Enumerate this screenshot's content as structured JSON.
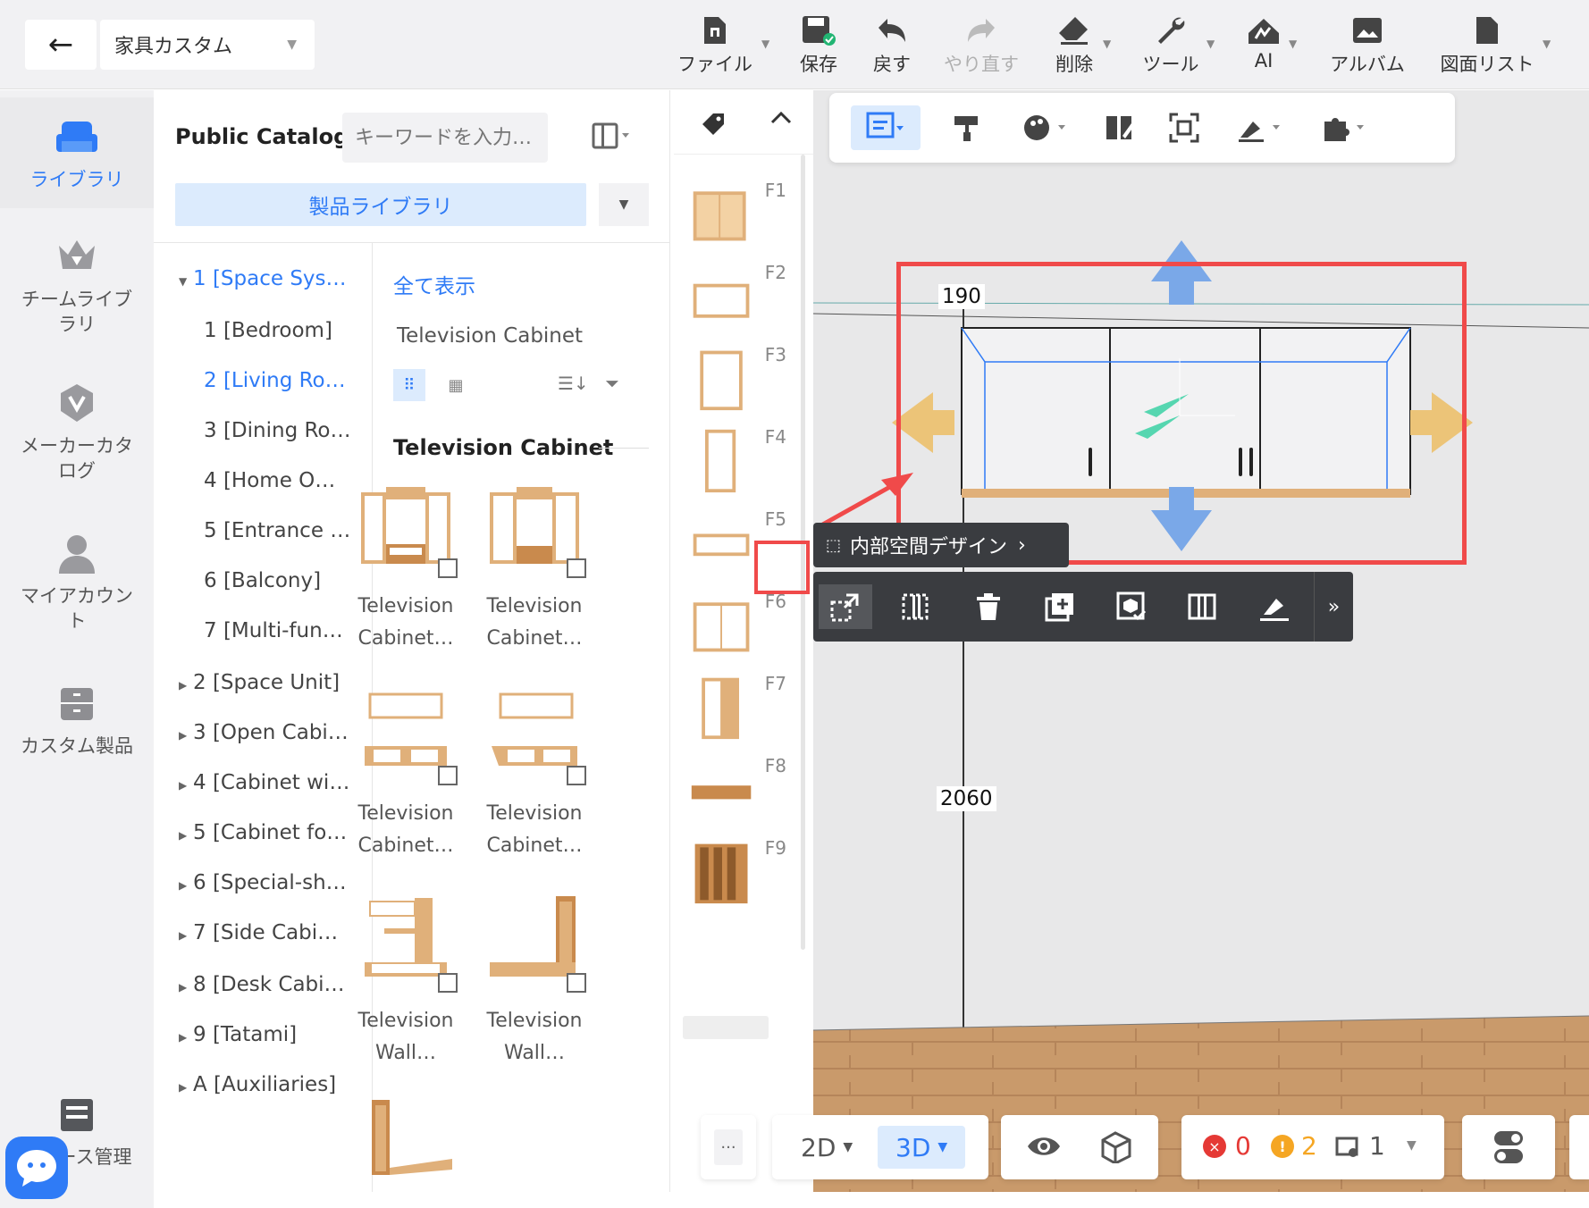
{
  "topbar": {
    "back_label": "←",
    "project_name": "家具カスタム",
    "items": [
      {
        "label": "ファイル",
        "icon": "file-icon"
      },
      {
        "label": "保存",
        "icon": "save-icon"
      },
      {
        "label": "戻す",
        "icon": "undo-icon"
      },
      {
        "label": "やり直す",
        "icon": "redo-icon",
        "disabled": true
      },
      {
        "label": "削除",
        "icon": "eraser-icon"
      },
      {
        "label": "ツール",
        "icon": "wrench-icon"
      },
      {
        "label": "AI",
        "icon": "ai-icon"
      },
      {
        "label": "アルバム",
        "icon": "album-icon"
      },
      {
        "label": "図面リスト",
        "icon": "drawing-list-icon"
      }
    ]
  },
  "rail": {
    "items": [
      {
        "label": "ライブラリ",
        "icon": "sofa-icon",
        "active": true
      },
      {
        "label": "チームライブラリ",
        "icon": "crown-icon"
      },
      {
        "label": "メーカーカタログ",
        "icon": "badge-icon"
      },
      {
        "label": "マイアカウント",
        "icon": "user-icon"
      },
      {
        "label": "カスタム製品",
        "icon": "cabinet-icon"
      },
      {
        "label": "ース管理",
        "icon": "manage-icon"
      }
    ]
  },
  "catalog": {
    "title": "Public Catalog",
    "search_placeholder": "キーワードを入力…",
    "library_tab": "製品ライブラリ",
    "tree": [
      {
        "label": "1 [Space Sys…",
        "level": 0,
        "expanded": true,
        "blue": true
      },
      {
        "label": "1 [Bedroom]",
        "level": 1
      },
      {
        "label": "2 [Living Ro…",
        "level": 1,
        "blue": true
      },
      {
        "label": "3 [Dining Ro…",
        "level": 1
      },
      {
        "label": "4 [Home O…",
        "level": 1
      },
      {
        "label": "5 [Entrance …",
        "level": 1
      },
      {
        "label": "6 [Balcony]",
        "level": 1
      },
      {
        "label": "7 [Multi-fun…",
        "level": 1
      },
      {
        "label": "2 [Space Unit]",
        "level": 0
      },
      {
        "label": "3 [Open Cabi…",
        "level": 0
      },
      {
        "label": "4 [Cabinet wi…",
        "level": 0
      },
      {
        "label": "5 [Cabinet fo…",
        "level": 0
      },
      {
        "label": "6 [Special-sh…",
        "level": 0
      },
      {
        "label": "7 [Side Cabi…",
        "level": 0
      },
      {
        "label": "8 [Desk Cabi…",
        "level": 0
      },
      {
        "label": "9 [Tatami]",
        "level": 0
      },
      {
        "label": "A [Auxiliaries]",
        "level": 0
      }
    ],
    "show_all": "全て表示",
    "subcategory": "Television Cabinet",
    "section_title": "Television Cabinet",
    "products": [
      {
        "line1": "Television",
        "line2": "Cabinet…"
      },
      {
        "line1": "Television",
        "line2": "Cabinet…"
      },
      {
        "line1": "Television",
        "line2": "Cabinet…"
      },
      {
        "line1": "Television",
        "line2": "Cabinet…"
      },
      {
        "line1": "Television",
        "line2": "Wall…"
      },
      {
        "line1": "Television",
        "line2": "Wall…"
      }
    ]
  },
  "fstrip": {
    "labels": [
      "F1",
      "F2",
      "F3",
      "F4",
      "F5",
      "F6",
      "F7",
      "F8",
      "F9"
    ],
    "highlighted": "F5"
  },
  "canvas": {
    "dim_top": "190",
    "dim_height": "2060",
    "inner_tip": "内部空間デザイン",
    "obj_toolbar": [
      "resize-icon",
      "split-icon",
      "trash-icon",
      "copy-add-icon",
      "inspect-icon",
      "divider-icon",
      "brush-icon"
    ]
  },
  "bottombar": {
    "more": "···",
    "view_2d": "2D",
    "view_3d": "3D",
    "errors": "0",
    "warnings": "2",
    "other": "1"
  },
  "colors": {
    "accent": "#2f7bf6",
    "highlight_red": "#f04a4a",
    "error": "#e53935",
    "warning": "#f5a623",
    "wood": "#e0b07a"
  }
}
